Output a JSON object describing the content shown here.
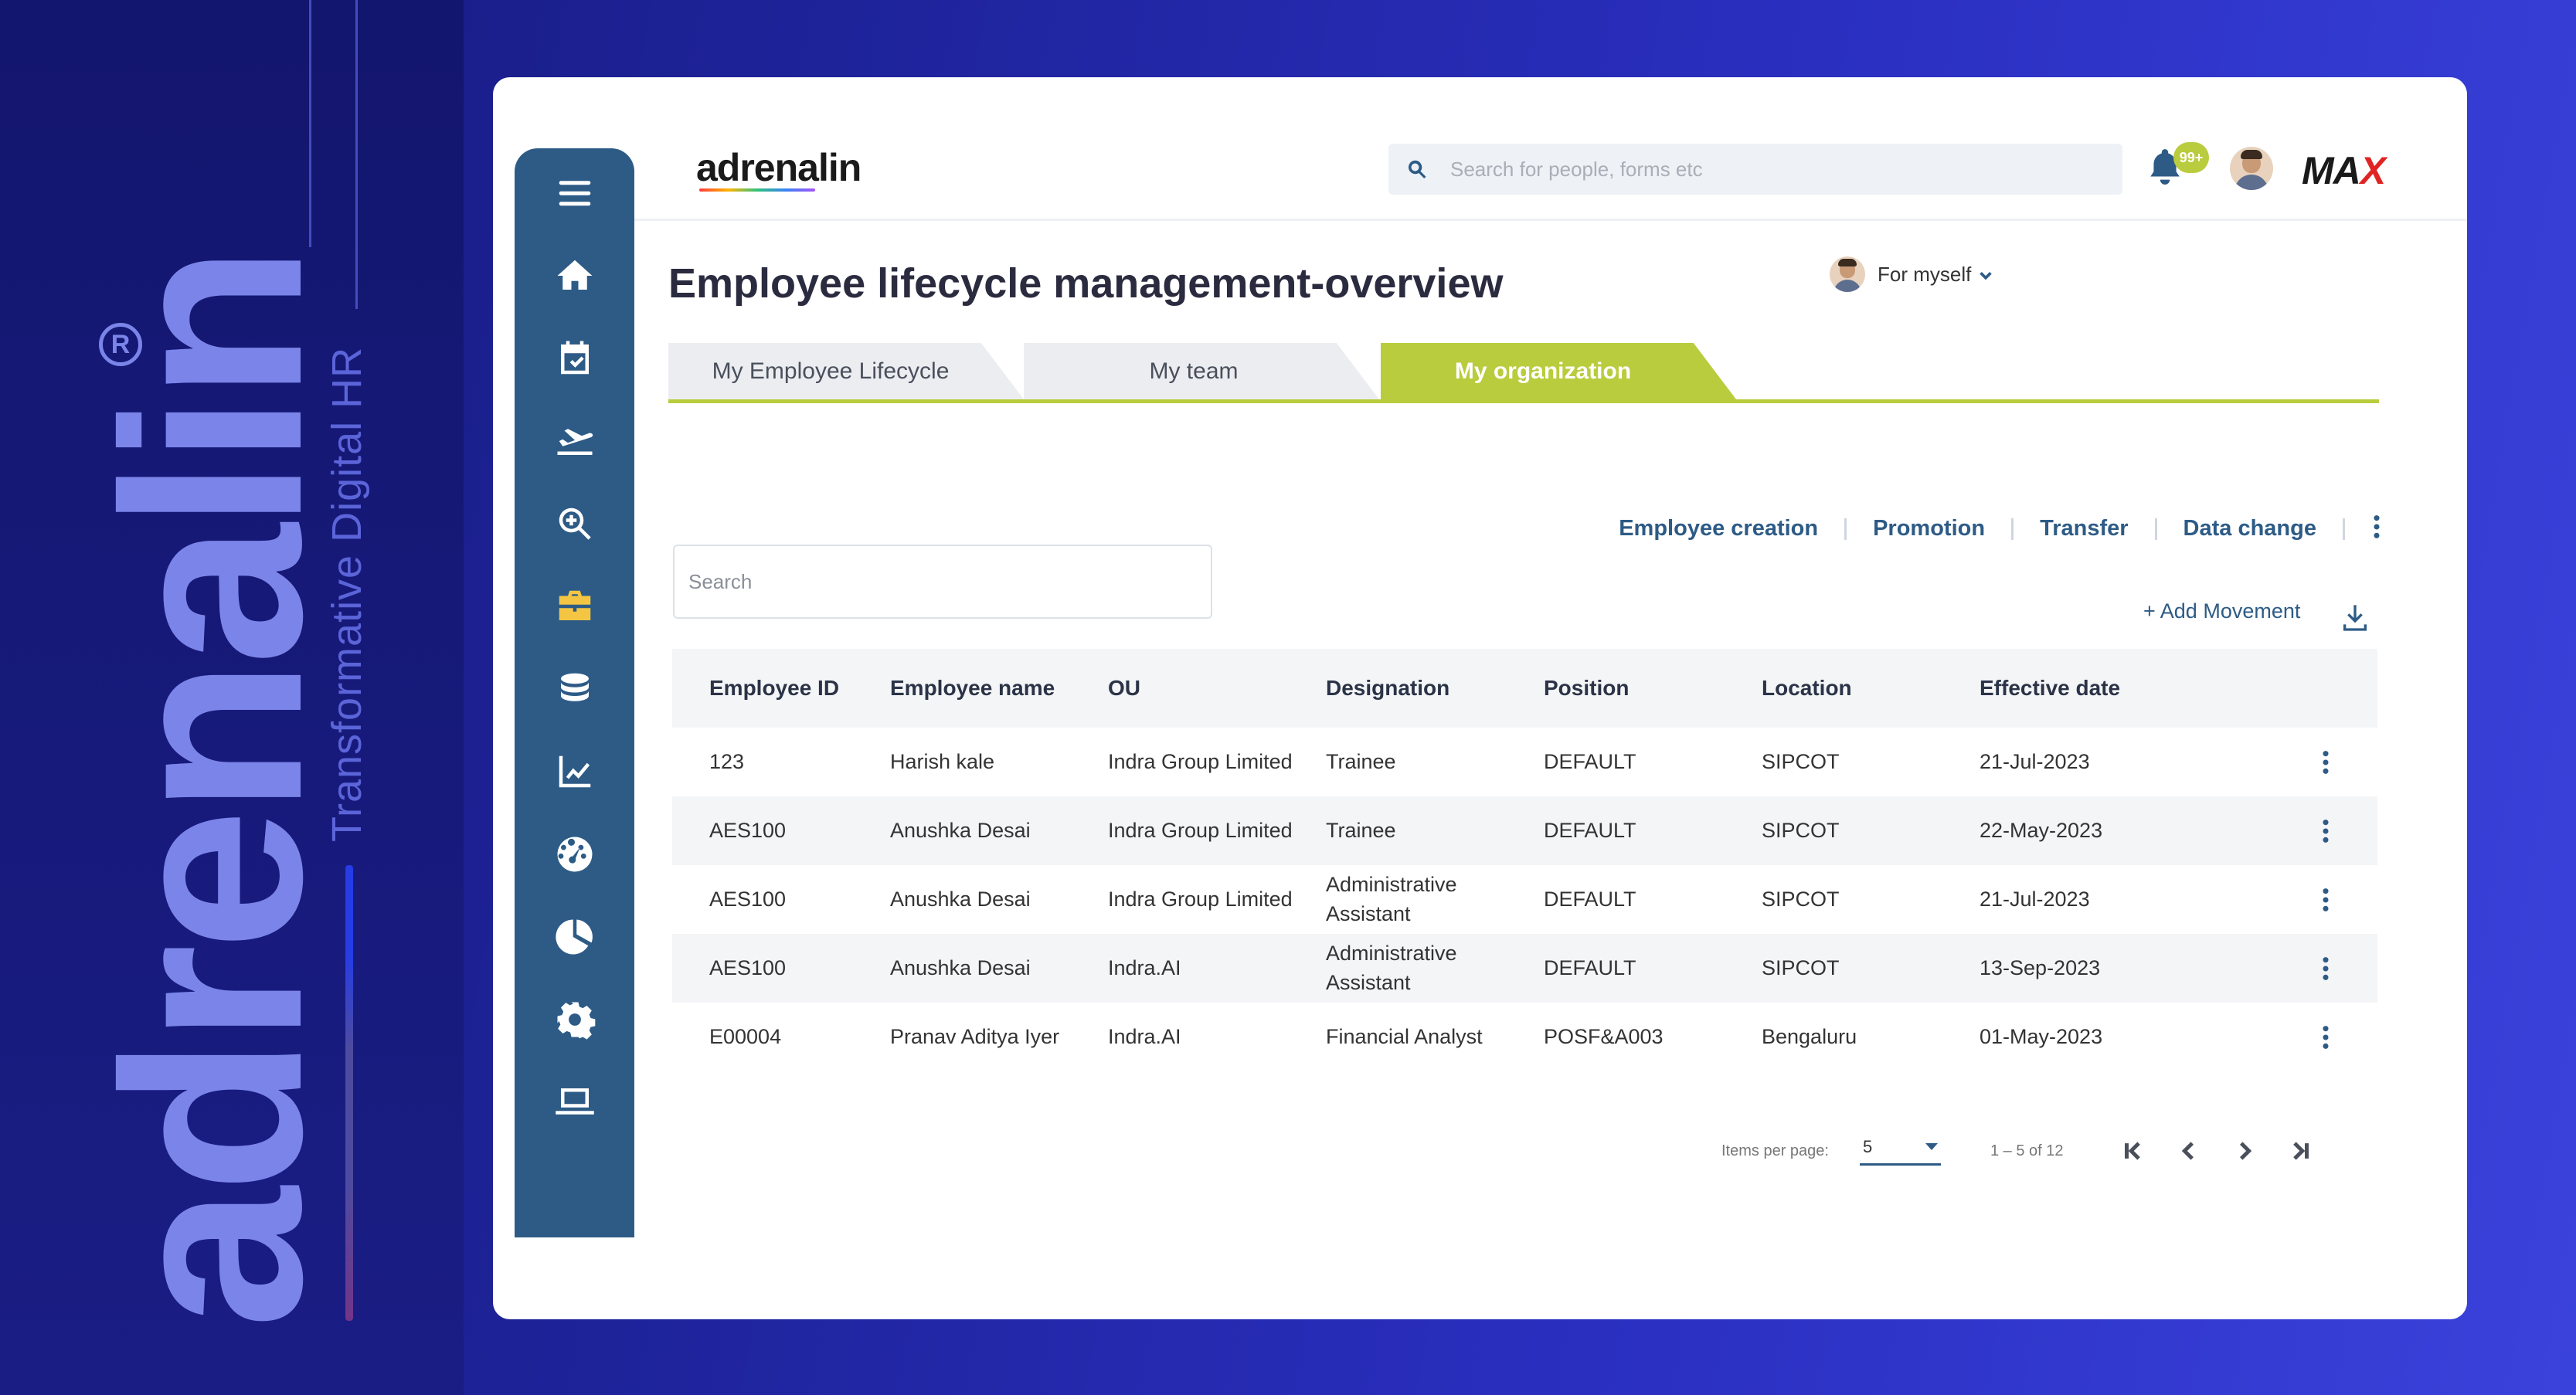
{
  "brand": {
    "big_word": "adrenalin",
    "registered": "R",
    "tagline": "Transformative Digital HR"
  },
  "header": {
    "logo": "adrenalin",
    "search_placeholder": "Search for people, forms etc",
    "notification_badge": "99+",
    "max_logo_prefix": "MA",
    "max_logo_x": "X"
  },
  "page": {
    "title": "Employee lifecycle management-overview",
    "for_myself": "For myself"
  },
  "tabs": [
    {
      "label": "My Employee Lifecycle"
    },
    {
      "label": "My team"
    },
    {
      "label": "My organization"
    }
  ],
  "actions": [
    {
      "label": "Employee creation"
    },
    {
      "label": "Promotion"
    },
    {
      "label": "Transfer"
    },
    {
      "label": "Data change"
    }
  ],
  "table_search_placeholder": "Search",
  "add_movement": "+ Add Movement",
  "table": {
    "columns": [
      "Employee ID",
      "Employee name",
      "OU",
      "Designation",
      "Position",
      "Location",
      "Effective date"
    ],
    "rows": [
      [
        "123",
        "Harish kale",
        "Indra Group Limited",
        "Trainee",
        "DEFAULT",
        "SIPCOT",
        "21-Jul-2023"
      ],
      [
        "AES100",
        "Anushka Desai",
        "Indra Group Limited",
        "Trainee",
        "DEFAULT",
        "SIPCOT",
        "22-May-2023"
      ],
      [
        "AES100",
        "Anushka Desai",
        "Indra Group Limited",
        "Administrative Assistant",
        "DEFAULT",
        "SIPCOT",
        "21-Jul-2023"
      ],
      [
        "AES100",
        "Anushka Desai",
        "Indra.AI",
        "Administrative Assistant",
        "DEFAULT",
        "SIPCOT",
        "13-Sep-2023"
      ],
      [
        "E00004",
        "Pranav Aditya Iyer",
        "Indra.AI",
        "Financial Analyst",
        "POSF&A003",
        "Bengaluru",
        "01-May-2023"
      ]
    ]
  },
  "pagination": {
    "items_per_page_label": "Items per page:",
    "items_per_page_value": "5",
    "range": "1 – 5 of 12"
  },
  "colors": {
    "accent": "#b9cc3e",
    "primary": "#2d5b86",
    "background": "#1e239a"
  },
  "sidebar_icons": [
    "menu-icon",
    "home-icon",
    "calendar-check-icon",
    "plane-icon",
    "search-zoom-icon",
    "briefcase-icon",
    "coins-icon",
    "line-chart-icon",
    "dashboard-gauge-icon",
    "pie-chart-icon",
    "settings-icon",
    "laptop-icon"
  ]
}
